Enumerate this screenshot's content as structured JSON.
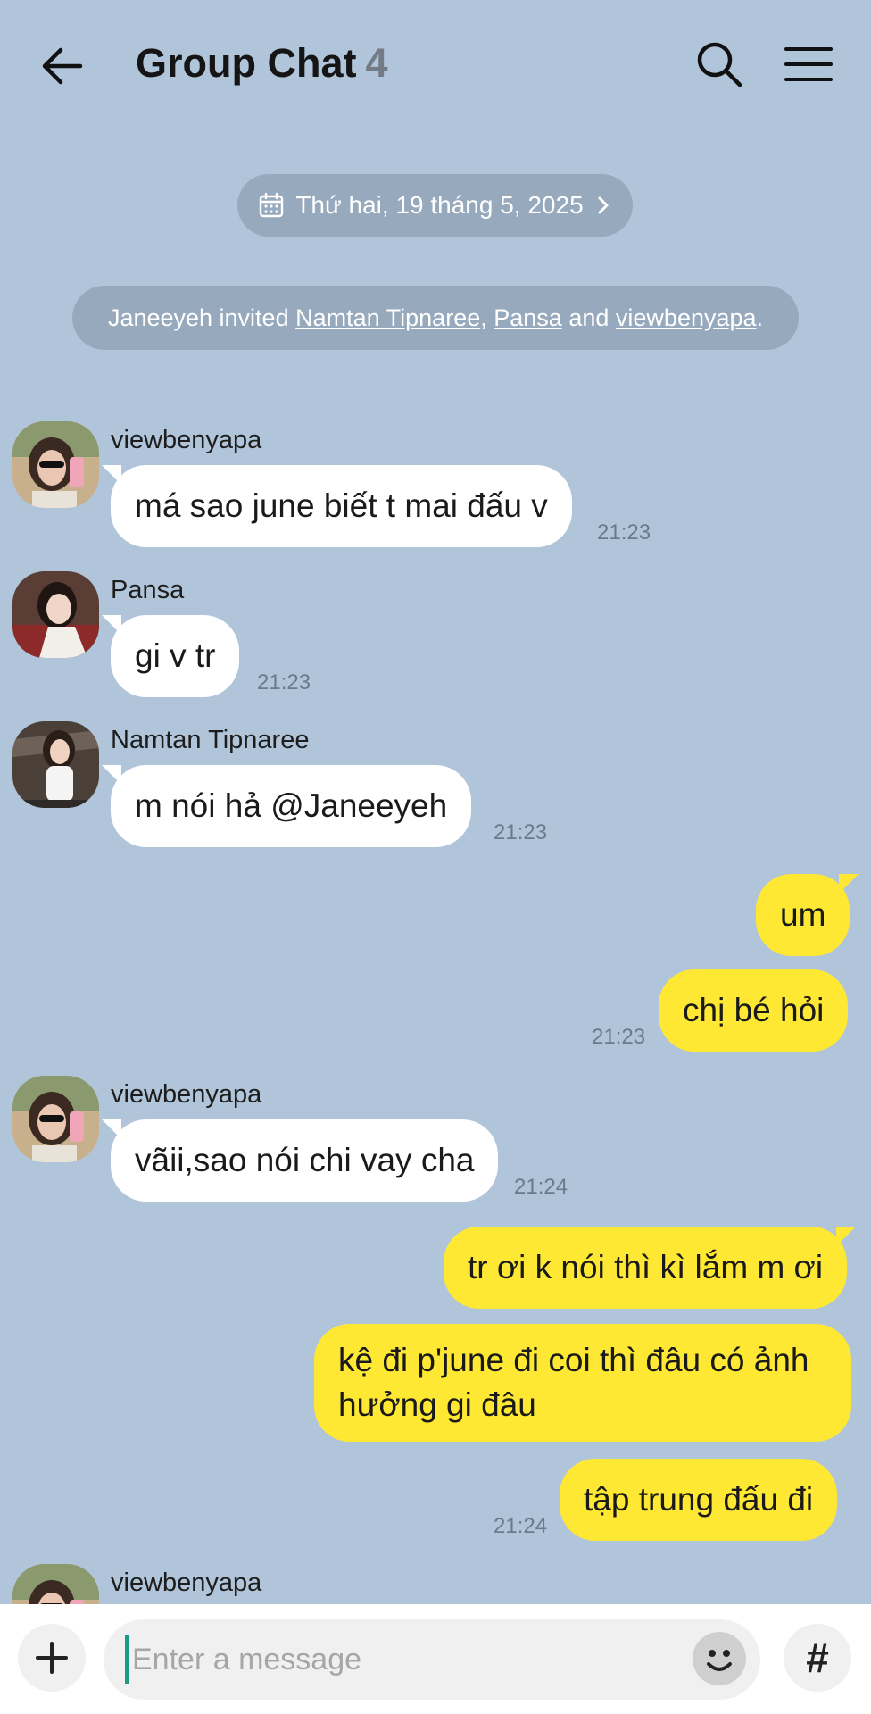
{
  "header": {
    "title": "Group Chat",
    "member_count": "4"
  },
  "date_pill": {
    "text": "Thứ hai, 19 tháng 5, 2025"
  },
  "system_message": {
    "inviter": "Janeeyeh invited ",
    "invitee_1": "Namtan Tipnaree",
    "sep_1": ", ",
    "invitee_2": "Pansa",
    "sep_2": " and ",
    "invitee_3": "viewbenyapa",
    "end": " ."
  },
  "messages": [
    {
      "sender": "viewbenyapa",
      "text": "má sao june biết t mai đấu v",
      "time": "21:23",
      "direction": "in"
    },
    {
      "sender": "Pansa",
      "text": "gi v tr",
      "time": "21:23",
      "direction": "in"
    },
    {
      "sender": "Namtan Tipnaree",
      "text": "m nói hả @Janeeyeh",
      "time": "21:23",
      "direction": "in"
    },
    {
      "text": "um",
      "direction": "out"
    },
    {
      "text": "chị bé hỏi",
      "time": "21:23",
      "direction": "out"
    },
    {
      "sender": "viewbenyapa",
      "text": "vãii,sao nói chi vay cha",
      "time": "21:24",
      "direction": "in"
    },
    {
      "text": "tr ơi k nói thì kì lắm m ơi",
      "direction": "out"
    },
    {
      "text": "kệ đi p'june đi coi thì đâu có ảnh hưởng gi đâu",
      "direction": "out"
    },
    {
      "text": "tập trung đấu đi",
      "time": "21:24",
      "direction": "out"
    },
    {
      "sender": "viewbenyapa",
      "direction": "in"
    }
  ],
  "input": {
    "placeholder": "Enter a message"
  },
  "hash_label": "#",
  "colors": {
    "background": "#b1c5da",
    "outgoing_bubble": "#fee833",
    "incoming_bubble": "#ffffff",
    "pill": "#97a9bd"
  },
  "icons": {
    "back": "arrow-left-icon",
    "search": "search-icon",
    "menu": "hamburger-menu-icon",
    "calendar": "calendar-icon",
    "chevron": "chevron-right-icon",
    "plus": "plus-icon",
    "emoji": "emoji-icon"
  }
}
